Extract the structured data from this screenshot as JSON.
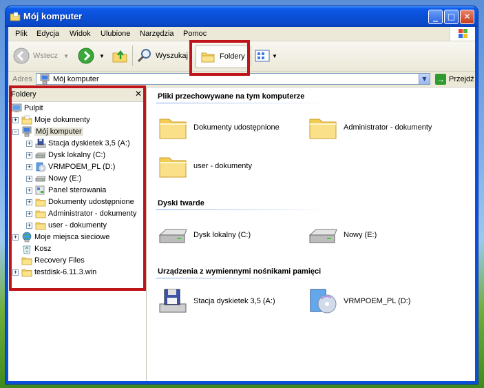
{
  "window": {
    "title": "Mój komputer",
    "minimize": "_",
    "maximize": "□",
    "close": "✕"
  },
  "menu": [
    "Plik",
    "Edycja",
    "Widok",
    "Ulubione",
    "Narzędzia",
    "Pomoc"
  ],
  "toolbar": {
    "back": "Wstecz",
    "search": "Wyszukaj",
    "folders": "Foldery"
  },
  "address": {
    "label": "Adres",
    "value": "Mój komputer",
    "go": "Przejdź"
  },
  "tree": {
    "header": "Foldery",
    "close": "✕",
    "items": [
      {
        "label": "Pulpit",
        "icon": "desktop-icon"
      },
      {
        "label": "Moje dokumenty",
        "icon": "documents-folder-icon"
      },
      {
        "label": "Mój komputer",
        "icon": "computer-icon"
      },
      {
        "label": "Stacja dyskietek 3,5 (A:)",
        "icon": "floppy-drive-icon"
      },
      {
        "label": "Dysk lokalny (C:)",
        "icon": "hard-drive-icon"
      },
      {
        "label": "VRMPOEM_PL (D:)",
        "icon": "cd-drive-icon"
      },
      {
        "label": "Nowy (E:)",
        "icon": "hard-drive-icon"
      },
      {
        "label": "Panel sterowania",
        "icon": "control-panel-icon"
      },
      {
        "label": "Dokumenty udostępnione",
        "icon": "folder-icon"
      },
      {
        "label": "Administrator - dokumenty",
        "icon": "folder-icon"
      },
      {
        "label": "user - dokumenty",
        "icon": "folder-icon"
      },
      {
        "label": "Moje miejsca sieciowe",
        "icon": "network-icon"
      },
      {
        "label": "Kosz",
        "icon": "recycle-bin-icon"
      },
      {
        "label": "Recovery Files",
        "icon": "folder-icon"
      },
      {
        "label": "testdisk-6.11.3.win",
        "icon": "folder-icon"
      }
    ]
  },
  "content": {
    "sections": [
      {
        "title": "Pliki przechowywane na tym komputerze",
        "items": [
          "Dokumenty udostępnione",
          "Administrator - dokumenty",
          "user - dokumenty"
        ]
      },
      {
        "title": "Dyski twarde",
        "items": [
          "Dysk lokalny (C:)",
          "Nowy (E:)"
        ]
      },
      {
        "title": "Urządzenia z wymiennymi nośnikami pamięci",
        "items": [
          "Stacja dyskietek 3,5 (A:)",
          "VRMPOEM_PL (D:)"
        ]
      }
    ]
  },
  "colors": {
    "highlight": "#c0141b",
    "titlebar": "#0a4fd6",
    "frame": "#ece9d8"
  }
}
